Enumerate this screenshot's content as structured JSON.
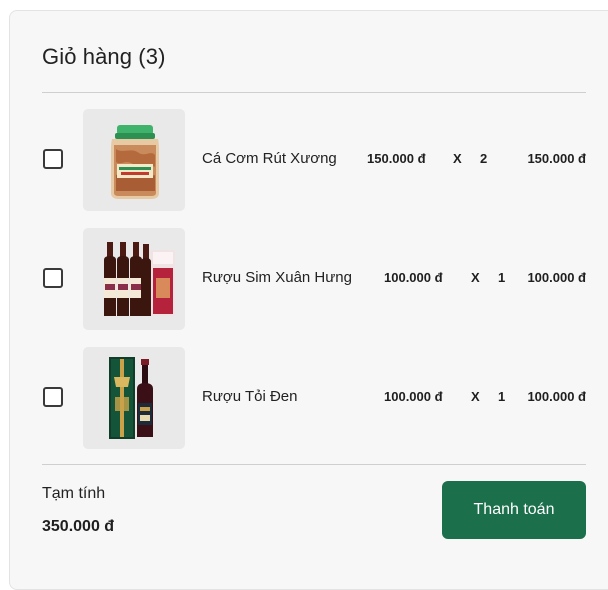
{
  "cart": {
    "title": "Giỏ hàng (3)",
    "items": [
      {
        "name": "Cá Cơm Rút Xương",
        "unit_price": "150.000 đ",
        "times": "X",
        "quantity": "2",
        "total": "150.000 đ",
        "image_icon": "jar-of-dried-fish-icon"
      },
      {
        "name": "Rượu Sim Xuân Hưng",
        "unit_price": "100.000 đ",
        "times": "X",
        "quantity": "1",
        "total": "100.000 đ",
        "image_icon": "wine-bottles-with-box-icon"
      },
      {
        "name": "Rượu Tỏi Đen",
        "unit_price": "100.000 đ",
        "times": "X",
        "quantity": "1",
        "total": "100.000 đ",
        "image_icon": "wine-bottle-with-gift-box-icon"
      }
    ],
    "subtotal_label": "Tạm tính",
    "subtotal_value": "350.000 đ",
    "checkout_label": "Thanh toán"
  },
  "colors": {
    "accent": "#1b6f4a",
    "panel_background": "#f7f7f7",
    "thumbnail_background": "#e9e9e9"
  }
}
